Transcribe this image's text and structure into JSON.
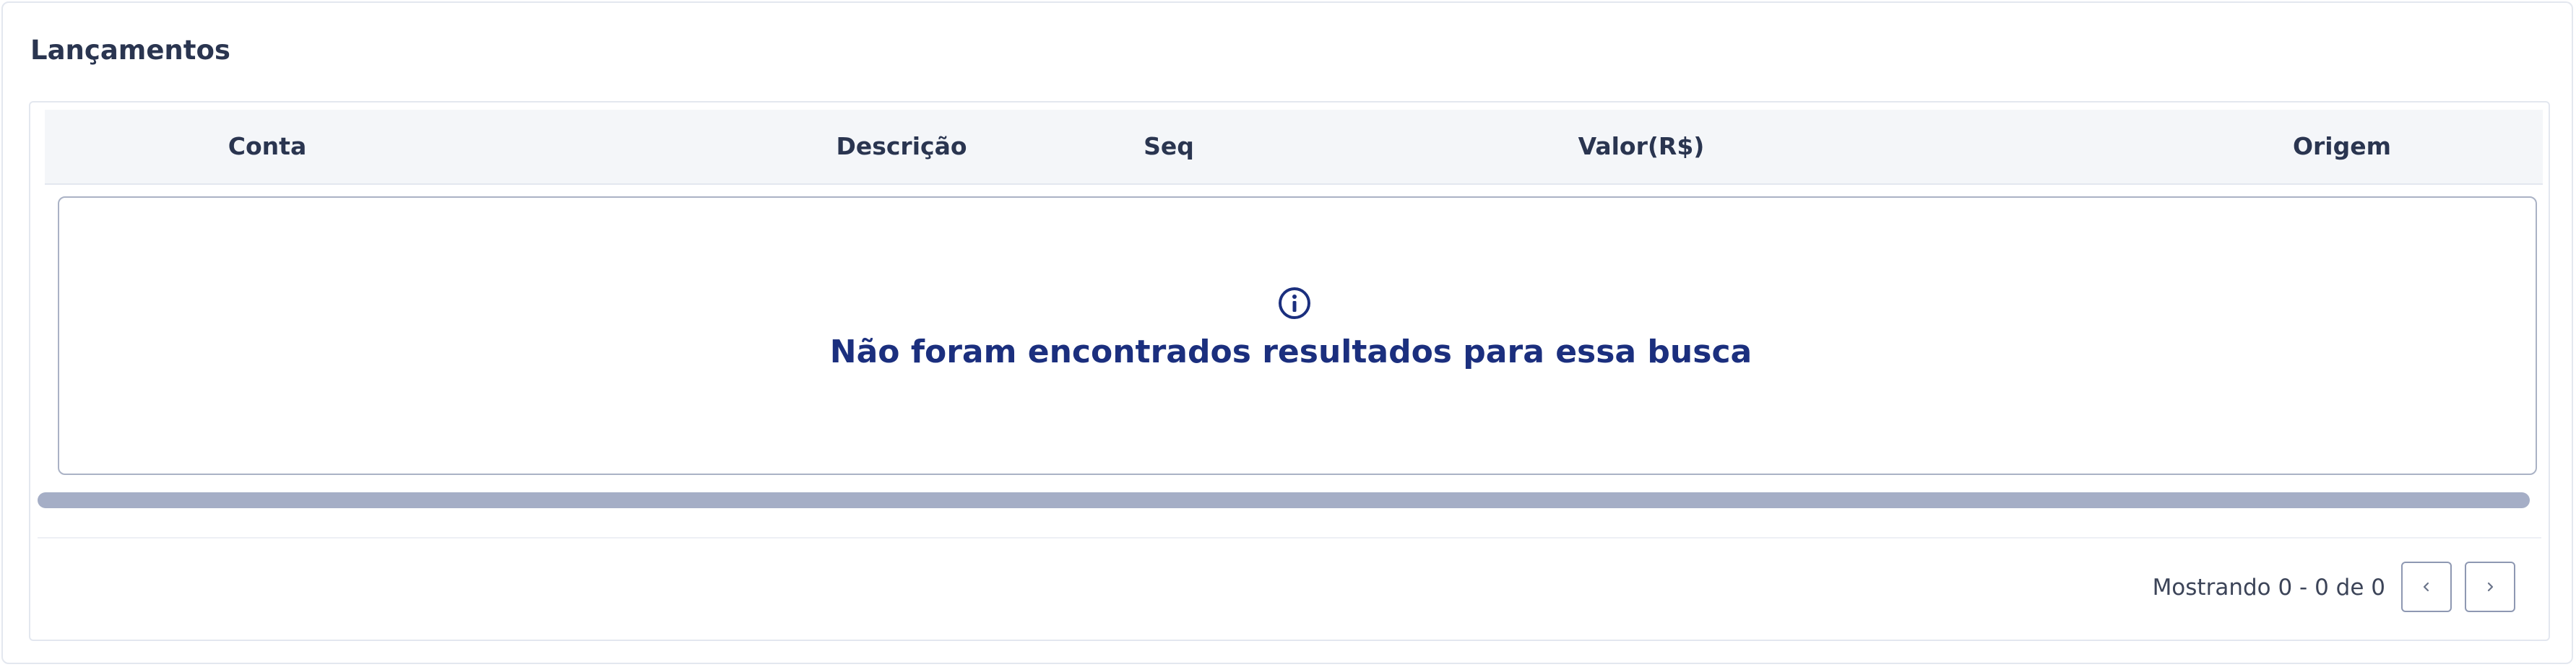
{
  "section": {
    "title": "Lançamentos"
  },
  "table": {
    "columns": [
      "Conta",
      "Descrição",
      "Seq",
      "Valor(R$)",
      "Origem"
    ],
    "rows": [],
    "empty_state": {
      "icon": "info-circle-icon",
      "message": "Não foram encontrados resultados para essa busca"
    }
  },
  "pagination": {
    "summary": "Mostrando 0 - 0 de 0",
    "prev_icon": "chevron-left-icon",
    "next_icon": "chevron-right-icon"
  },
  "colors": {
    "accent": "#1b2f7e",
    "header_bg": "#f4f6f9",
    "scrollbar": "#a5aec6"
  }
}
